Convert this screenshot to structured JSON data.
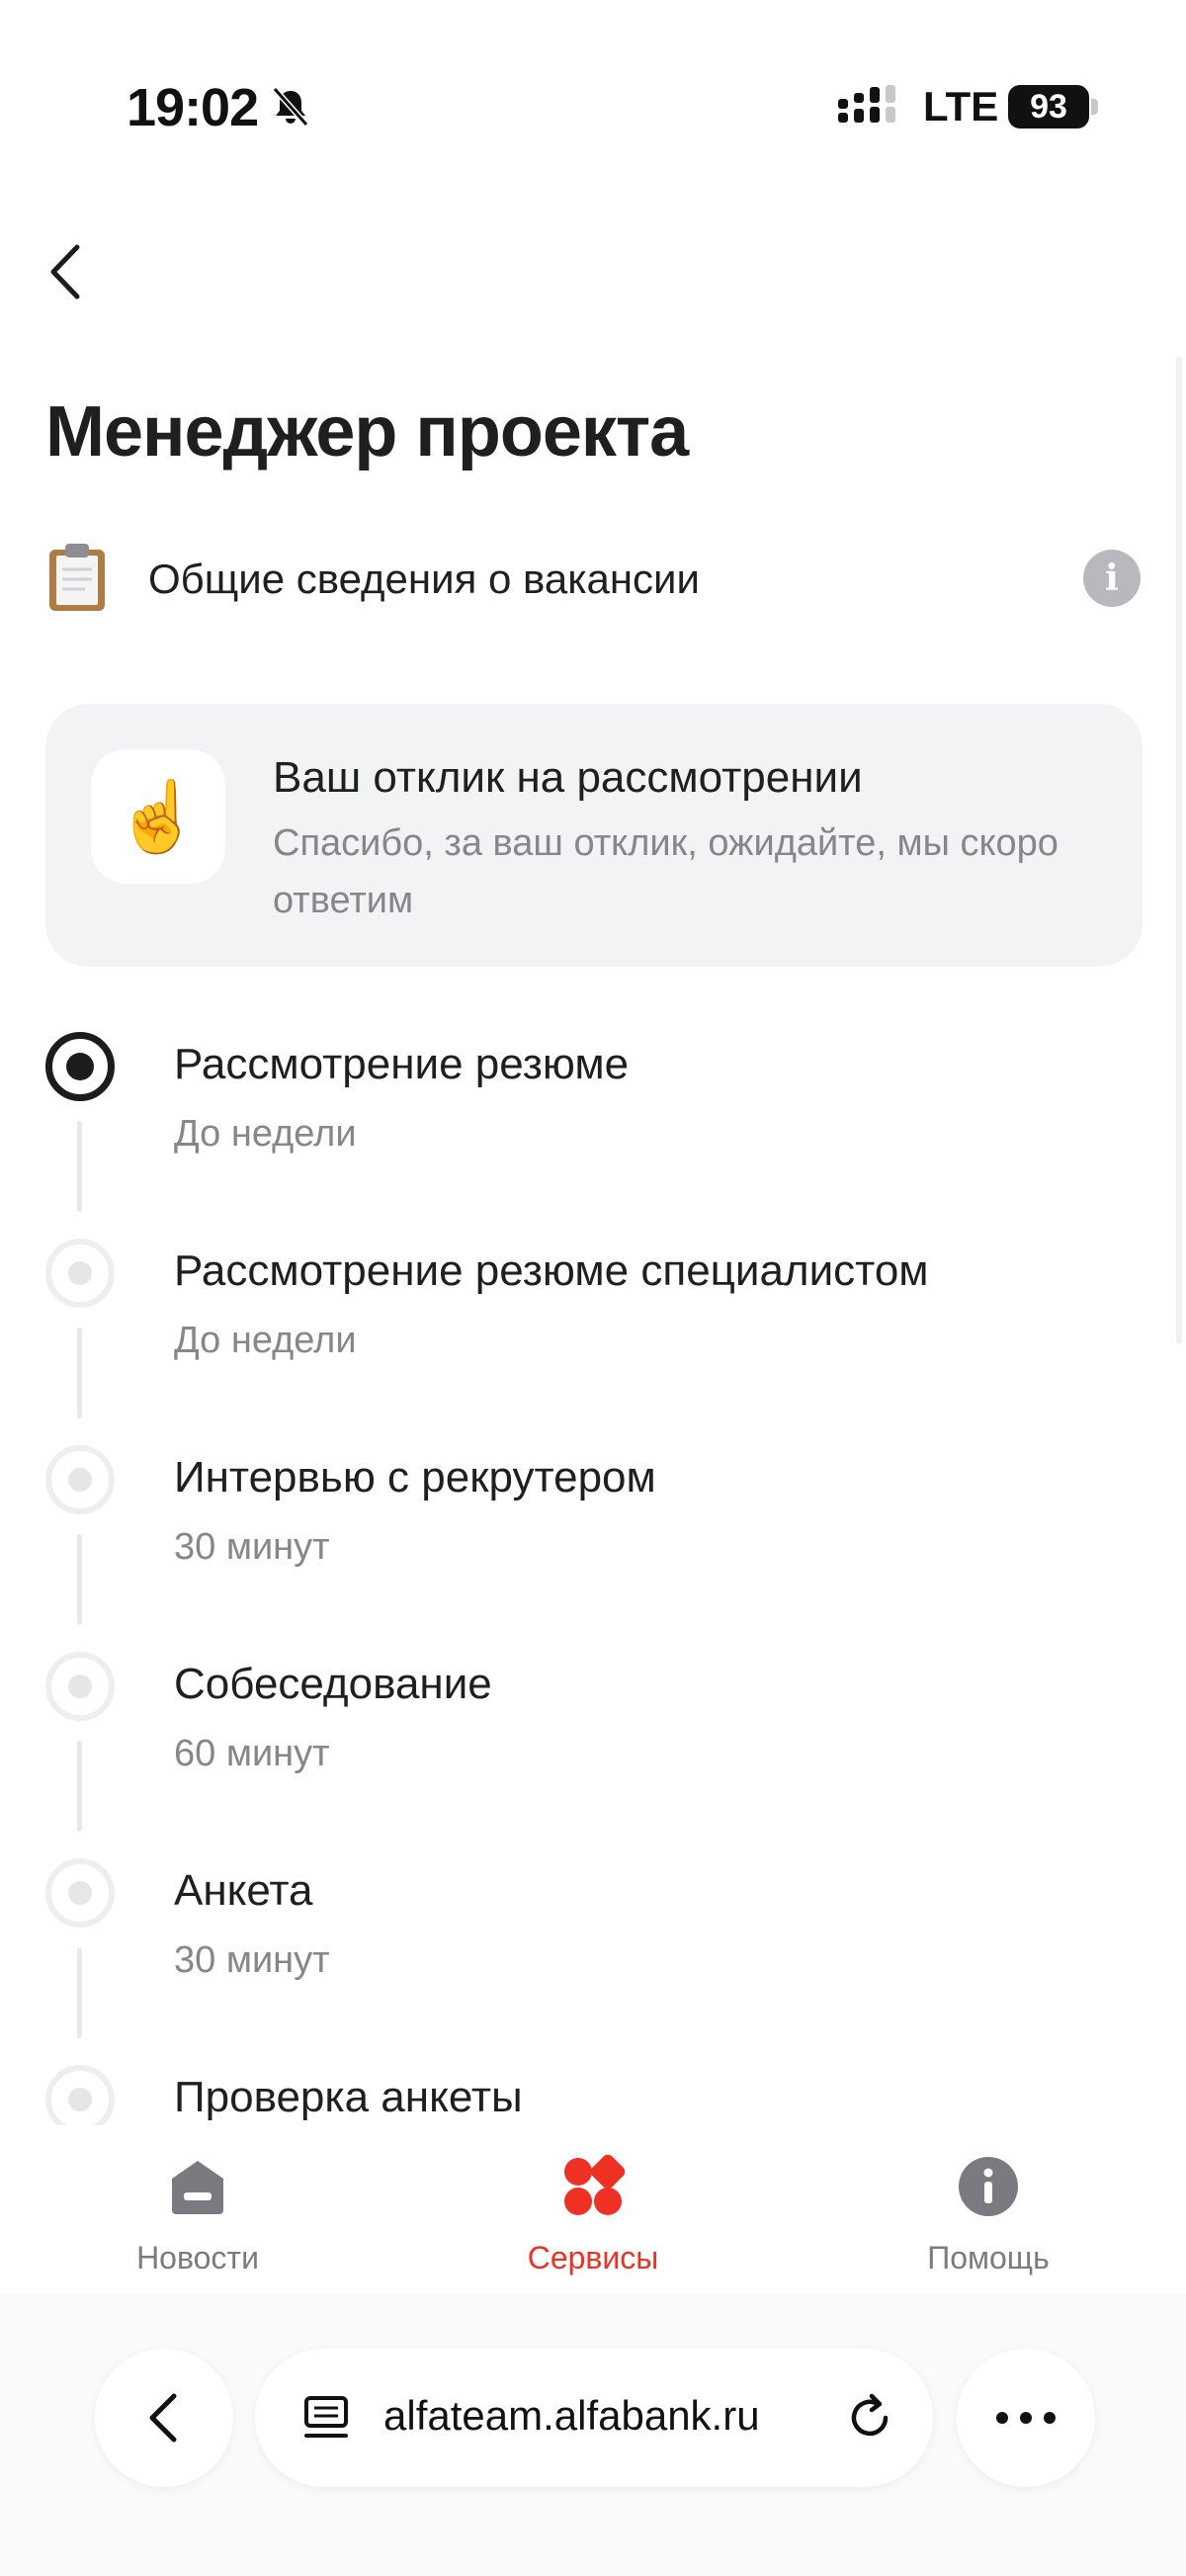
{
  "status_bar": {
    "time": "19:02",
    "network": "LTE",
    "battery": "93"
  },
  "header": {
    "title": "Менеджер проекта",
    "info_label": "Общие сведения о вакансии"
  },
  "status_card": {
    "emoji": "☝️",
    "title": "Ваш отклик на рассмотрении",
    "text": "Спасибо, за ваш отклик, ожидайте, мы скоро ответим"
  },
  "steps": [
    {
      "title": "Рассмотрение резюме",
      "subtitle": "До недели",
      "active": true
    },
    {
      "title": "Рассмотрение резюме специалистом",
      "subtitle": "До недели",
      "active": false
    },
    {
      "title": "Интервью с рекрутером",
      "subtitle": "30 минут",
      "active": false
    },
    {
      "title": "Собеседование",
      "subtitle": "60 минут",
      "active": false
    },
    {
      "title": "Анкета",
      "subtitle": "30 минут",
      "active": false
    },
    {
      "title": "Проверка анкеты",
      "subtitle": "",
      "active": false
    }
  ],
  "tabbar": {
    "tabs": [
      {
        "label": "Новости",
        "icon": "home-icon",
        "active": false
      },
      {
        "label": "Сервисы",
        "icon": "services-icon",
        "active": true
      },
      {
        "label": "Помощь",
        "icon": "help-info-icon",
        "active": false
      }
    ]
  },
  "browser": {
    "url": "alfateam.alfabank.ru"
  },
  "colors": {
    "accent": "#ef3124",
    "card_bg": "#f2f3f5",
    "muted_text": "#86868c"
  }
}
